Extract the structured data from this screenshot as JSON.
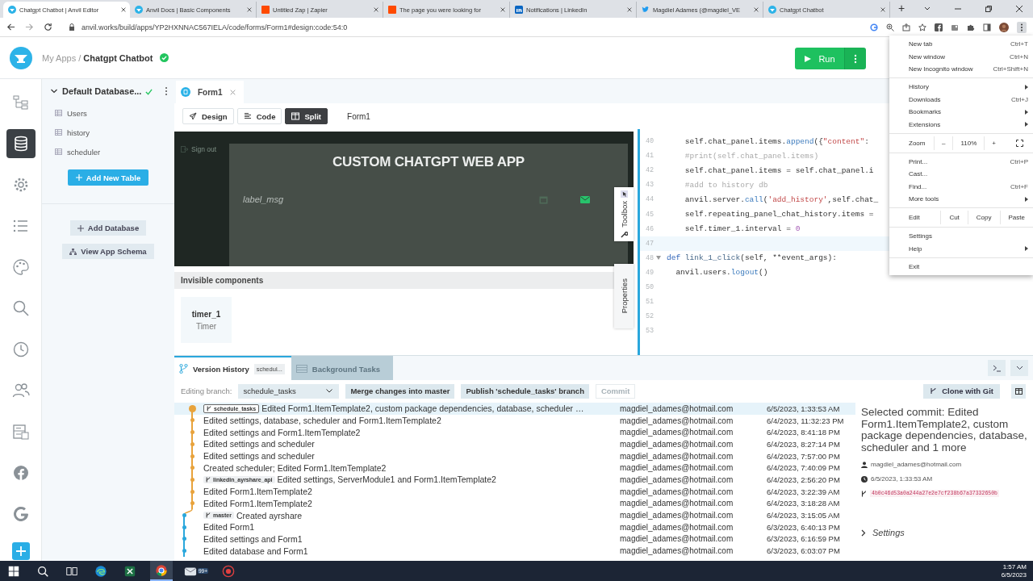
{
  "browser": {
    "tabs": [
      {
        "title": "Chatgpt Chatbot | Anvil Editor",
        "kind": "anvil",
        "selected": true
      },
      {
        "title": "Anvil Docs | Basic Components",
        "kind": "anvil",
        "selected": false
      },
      {
        "title": "Untitled Zap | Zapier",
        "kind": "zapier",
        "selected": false
      },
      {
        "title": "The page you were looking for",
        "kind": "zapier",
        "selected": false
      },
      {
        "title": "Notifications | LinkedIn",
        "kind": "linkedin",
        "selected": false
      },
      {
        "title": "Magdiel Adames (@magdiel_VE",
        "kind": "twitter",
        "selected": false
      },
      {
        "title": "Chatgpt Chatbot",
        "kind": "anvil",
        "selected": false
      }
    ],
    "new_tab": "+",
    "url": "anvil.works/build/apps/YP2HXNNAC567IELA/code/forms/Form1#design:code:54:0"
  },
  "app": {
    "breadcrumb_root": "My Apps",
    "separator": "/",
    "app_name": "Chatgpt Chatbot",
    "saved": true,
    "run_label": "Run"
  },
  "rail": [
    {
      "kind": "tree",
      "selected": false
    },
    {
      "kind": "database",
      "selected": true
    },
    {
      "kind": "gear",
      "selected": false
    },
    {
      "kind": "list",
      "selected": false
    },
    {
      "kind": "palette",
      "selected": false
    },
    {
      "kind": "search",
      "selected": false
    },
    {
      "kind": "clock",
      "selected": false
    },
    {
      "kind": "users",
      "selected": false
    },
    {
      "kind": "server",
      "selected": false
    },
    {
      "kind": "facebook",
      "selected": false
    },
    {
      "kind": "google",
      "selected": false
    },
    {
      "kind": "add",
      "selected": false
    }
  ],
  "sidebar": {
    "title": "Default Database...",
    "saved": true,
    "tables": [
      "Users",
      "history",
      "scheduler"
    ],
    "add_table": "Add New Table",
    "add_database": "Add Database",
    "schema": "View App Schema"
  },
  "editor": {
    "tab": "Form1",
    "modes": [
      {
        "label": "Design",
        "selected": false
      },
      {
        "label": "Code",
        "selected": false
      },
      {
        "label": "Split",
        "selected": true
      }
    ],
    "form_name": "Form1"
  },
  "preview": {
    "sign_out": "Sign out",
    "title": "CUSTOM CHATGPT WEB APP",
    "label": "label_msg"
  },
  "side_strips": [
    {
      "label": "Toolbox"
    },
    {
      "label": "Properties"
    }
  ],
  "invisible": {
    "title": "Invisible components",
    "components": [
      {
        "name": "timer_1",
        "type": "Timer"
      }
    ]
  },
  "code": {
    "lines": [
      {
        "number": "40",
        "current": false,
        "foldable": false,
        "tokens": [
          {
            "t": "    self.chat_panel.items.",
            "kind": "plain"
          },
          {
            "t": "append",
            "kind": "call"
          },
          {
            "t": "({",
            "kind": "plain"
          },
          {
            "t": "\"content\"",
            "kind": "str"
          },
          {
            "t": ":",
            "kind": "plain"
          }
        ]
      },
      {
        "number": "41",
        "current": false,
        "foldable": false,
        "tokens": [
          {
            "t": "    #print(self.chat_panel.items)",
            "kind": "comment"
          }
        ]
      },
      {
        "number": "42",
        "current": false,
        "foldable": false,
        "tokens": [
          {
            "t": "    self.chat_panel.items = self.chat_panel.i",
            "kind": "plain"
          }
        ]
      },
      {
        "number": "43",
        "current": false,
        "foldable": false,
        "tokens": [
          {
            "t": "    #add to history db",
            "kind": "comment"
          }
        ]
      },
      {
        "number": "44",
        "current": false,
        "foldable": false,
        "tokens": [
          {
            "t": "    anvil.server.",
            "kind": "plain"
          },
          {
            "t": "call",
            "kind": "call"
          },
          {
            "t": "(",
            "kind": "plain"
          },
          {
            "t": "'add_history'",
            "kind": "str"
          },
          {
            "t": ",self.chat_",
            "kind": "plain"
          }
        ]
      },
      {
        "number": "45",
        "current": false,
        "foldable": false,
        "tokens": [
          {
            "t": "    self.repeating_panel_chat_history.items =",
            "kind": "plain"
          }
        ]
      },
      {
        "number": "46",
        "current": false,
        "foldable": false,
        "tokens": [
          {
            "t": "    self.timer_1.interval = ",
            "kind": "plain"
          },
          {
            "t": "0",
            "kind": "num"
          }
        ]
      },
      {
        "number": "47",
        "current": true,
        "foldable": false
      },
      {
        "number": "48",
        "current": false,
        "foldable": true,
        "tokens": [
          {
            "t": "def ",
            "kind": "kw"
          },
          {
            "t": "link_1_click",
            "kind": "def"
          },
          {
            "t": "(self, **event_args):",
            "kind": "plain"
          }
        ]
      },
      {
        "number": "49",
        "current": false,
        "foldable": false,
        "tokens": [
          {
            "t": "  anvil.users.",
            "kind": "plain"
          },
          {
            "t": "logout",
            "kind": "call"
          },
          {
            "t": "()",
            "kind": "plain"
          }
        ]
      },
      {
        "number": "50",
        "current": false,
        "foldable": false
      },
      {
        "number": "51",
        "current": false,
        "foldable": false
      },
      {
        "number": "52",
        "current": false,
        "foldable": false
      },
      {
        "number": "53",
        "current": false,
        "foldable": false
      }
    ]
  },
  "version_history": {
    "tabs": [
      {
        "label": "Version History",
        "badge": "schedul...",
        "selected": true
      },
      {
        "label": "Background Tasks",
        "selected": false
      }
    ],
    "branch_label": "Editing branch:",
    "branch": "schedule_tasks",
    "actions": [
      {
        "label": "Merge changes into master",
        "disabled": false
      },
      {
        "label": "Publish 'schedule_tasks' branch",
        "disabled": false
      },
      {
        "label": "Commit",
        "disabled": true
      }
    ],
    "clone": "Clone with Git",
    "commits": [
      {
        "kind": "branch",
        "color": "#e8a33c",
        "selected": true,
        "tag": "schedule_tasks",
        "message": "Edited Form1.ItemTemplate2, custom package dependencies, database, scheduler …",
        "author": "magdiel_adames@hotmail.com",
        "date": "6/5/2023, 1:33:53 AM"
      },
      {
        "kind": "branch",
        "color": "#e8a33c",
        "selected": false,
        "message": "Edited settings, database, scheduler and Form1.ItemTemplate2",
        "author": "magdiel_adames@hotmail.com",
        "date": "6/4/2023, 11:32:23 PM"
      },
      {
        "kind": "branch",
        "color": "#e8a33c",
        "selected": false,
        "message": "Edited settings and Form1.ItemTemplate2",
        "author": "magdiel_adames@hotmail.com",
        "date": "6/4/2023, 8:41:18 PM"
      },
      {
        "kind": "branch",
        "color": "#e8a33c",
        "selected": false,
        "message": "Edited settings and scheduler",
        "author": "magdiel_adames@hotmail.com",
        "date": "6/4/2023, 8:27:14 PM"
      },
      {
        "kind": "branch",
        "color": "#e8a33c",
        "selected": false,
        "message": "Edited settings and scheduler",
        "author": "magdiel_adames@hotmail.com",
        "date": "6/4/2023, 7:57:00 PM"
      },
      {
        "kind": "branch",
        "color": "#e8a33c",
        "selected": false,
        "message": "Created scheduler; Edited Form1.ItemTemplate2",
        "author": "magdiel_adames@hotmail.com",
        "date": "6/4/2023, 7:40:09 PM"
      },
      {
        "kind": "branch",
        "color": "#e8a33c",
        "selected": false,
        "tag": "linkedin_ayrshare_api",
        "message": "Edited settings, ServerModule1 and Form1.ItemTemplate2",
        "author": "magdiel_adames@hotmail.com",
        "date": "6/4/2023, 2:56:20 PM"
      },
      {
        "kind": "branch",
        "color": "#e8a33c",
        "selected": false,
        "message": "Edited Form1.ItemTemplate2",
        "author": "magdiel_adames@hotmail.com",
        "date": "6/4/2023, 3:22:39 AM"
      },
      {
        "kind": "branch",
        "color": "#e8a33c",
        "selected": false,
        "message": "Edited Form1.ItemTemplate2",
        "author": "magdiel_adames@hotmail.com",
        "date": "6/4/2023, 3:18:28 AM"
      },
      {
        "kind": "trunk",
        "color": "#2aa7dc",
        "selected": false,
        "tag": "master",
        "message": "Created ayrshare",
        "author": "magdiel_adames@hotmail.com",
        "date": "6/4/2023, 3:15:05 AM"
      },
      {
        "kind": "trunk",
        "color": "#2aa7dc",
        "selected": false,
        "message": "Edited Form1",
        "author": "magdiel_adames@hotmail.com",
        "date": "6/3/2023, 6:40:13 PM"
      },
      {
        "kind": "trunk",
        "color": "#2aa7dc",
        "selected": false,
        "message": "Edited settings and Form1",
        "author": "magdiel_adames@hotmail.com",
        "date": "6/3/2023, 6:16:59 PM"
      },
      {
        "kind": "trunk",
        "color": "#2aa7dc",
        "selected": false,
        "message": "Edited database and Form1",
        "author": "magdiel_adames@hotmail.com",
        "date": "6/3/2023, 6:03:07 PM"
      }
    ],
    "selected_commit": {
      "title": "Selected commit: Edited Form1.ItemTemplate2, custom package dependencies, database, scheduler and 1 more",
      "author": "magdiel_adames@hotmail.com",
      "date": "6/5/2023, 1:33:53 AM",
      "hash": "4b0c46d53a0a244a27e2e7cf238b67a37332650b",
      "settings": "Settings"
    }
  },
  "chrome_menu": {
    "items": [
      {
        "kind": "item",
        "label": "New tab",
        "shortcut": "Ctrl+T",
        "submenu": false
      },
      {
        "kind": "item",
        "label": "New window",
        "shortcut": "Ctrl+N",
        "submenu": false
      },
      {
        "kind": "item",
        "label": "New Incognito window",
        "shortcut": "Ctrl+Shift+N",
        "submenu": false
      },
      {
        "kind": "separator"
      },
      {
        "kind": "item",
        "label": "History",
        "submenu": true
      },
      {
        "kind": "item",
        "label": "Downloads",
        "shortcut": "Ctrl+J",
        "submenu": false
      },
      {
        "kind": "item",
        "label": "Bookmarks",
        "submenu": true
      },
      {
        "kind": "item",
        "label": "Extensions",
        "submenu": true
      },
      {
        "kind": "separator"
      },
      {
        "kind": "zoom",
        "label": "Zoom",
        "minus": "–",
        "value": "110%",
        "plus": "+"
      },
      {
        "kind": "separator"
      },
      {
        "kind": "item",
        "label": "Print...",
        "shortcut": "Ctrl+P",
        "submenu": false
      },
      {
        "kind": "item",
        "label": "Cast...",
        "submenu": false
      },
      {
        "kind": "item",
        "label": "Find...",
        "shortcut": "Ctrl+F",
        "submenu": false
      },
      {
        "kind": "item",
        "label": "More tools",
        "submenu": true
      },
      {
        "kind": "separator"
      },
      {
        "kind": "edit",
        "label": "Edit",
        "actions": [
          "Cut",
          "Copy",
          "Paste"
        ]
      },
      {
        "kind": "separator"
      },
      {
        "kind": "item",
        "label": "Settings",
        "submenu": false
      },
      {
        "kind": "item",
        "label": "Help",
        "submenu": true
      },
      {
        "kind": "separator"
      },
      {
        "kind": "item",
        "label": "Exit",
        "submenu": false
      }
    ]
  },
  "taskbar": {
    "apps": [
      {
        "kind": "start",
        "active": false
      },
      {
        "kind": "search",
        "active": false
      },
      {
        "kind": "taskview",
        "active": false
      },
      {
        "kind": "edge",
        "active": false
      },
      {
        "kind": "excel",
        "active": false
      },
      {
        "kind": "chrome",
        "active": true
      },
      {
        "kind": "mail",
        "active": false,
        "badge": "99+"
      },
      {
        "kind": "recorder",
        "active": false
      }
    ],
    "time": "1:57 AM",
    "date": "6/5/2023"
  }
}
